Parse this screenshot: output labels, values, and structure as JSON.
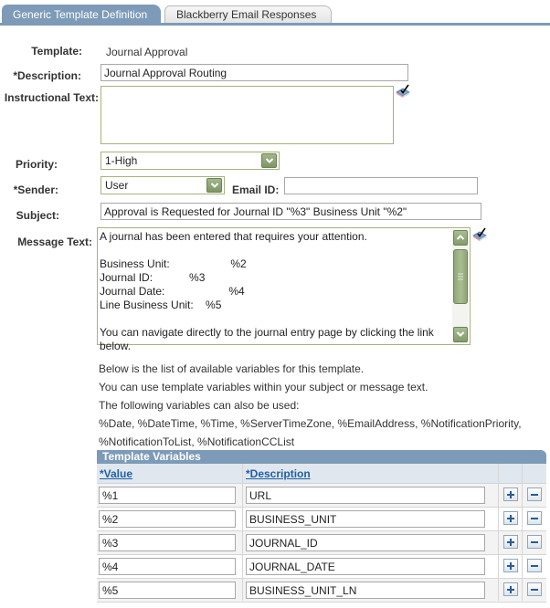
{
  "tabs": [
    {
      "label": "Generic Template Definition",
      "active": true
    },
    {
      "label": "Blackberry Email Responses",
      "active": false
    }
  ],
  "form": {
    "template_label": "Template:",
    "template_value": "Journal Approval",
    "description_label": "*Description:",
    "description_value": "Journal Approval Routing",
    "instructional_label": "Instructional Text:",
    "instructional_value": "",
    "priority_label": "Priority:",
    "priority_value": "1-High",
    "sender_label": "*Sender:",
    "sender_value": "User",
    "email_label": "Email ID:",
    "email_value": "",
    "subject_label": "Subject:",
    "subject_value": "Approval is Requested for Journal ID \"%3\" Business Unit \"%2\"",
    "message_label": "Message Text:",
    "message_lines": [
      "A journal has been entered that requires your attention.",
      "",
      "Business Unit:                    %2",
      "Journal ID:            %3",
      "Journal Date:                     %4",
      "Line Business Unit:    %5",
      "",
      "You can navigate directly to the journal entry page by clicking the link",
      "below."
    ]
  },
  "icons": {
    "spellcheck": "spell-check-icon",
    "scroll_up": "chevron-up-icon",
    "scroll_down": "chevron-down-icon",
    "dropdown": "chevron-down-icon",
    "add": "plus-icon",
    "remove": "minus-icon"
  },
  "info": [
    "Below is the list of available variables for this template.",
    "You can use template variables within your subject or message text.",
    "The following variables can also be used:",
    "%Date, %DateTime, %Time, %ServerTimeZone, %EmailAddress, %NotificationPriority,",
    "%NotificationToList, %NotificationCCList"
  ],
  "grid": {
    "title": "Template Variables",
    "columns": [
      "*Value",
      "*Description"
    ],
    "rows": [
      {
        "value": "%1",
        "description": "URL"
      },
      {
        "value": "%2",
        "description": "BUSINESS_UNIT"
      },
      {
        "value": "%3",
        "description": "JOURNAL_ID"
      },
      {
        "value": "%4",
        "description": "JOURNAL_DATE"
      },
      {
        "value": "%5",
        "description": "BUSINESS_UNIT_LN"
      }
    ]
  },
  "colors": {
    "accent": "#7d9bb8",
    "field_border": "#a4b37e",
    "link": "#1f5fa6"
  }
}
